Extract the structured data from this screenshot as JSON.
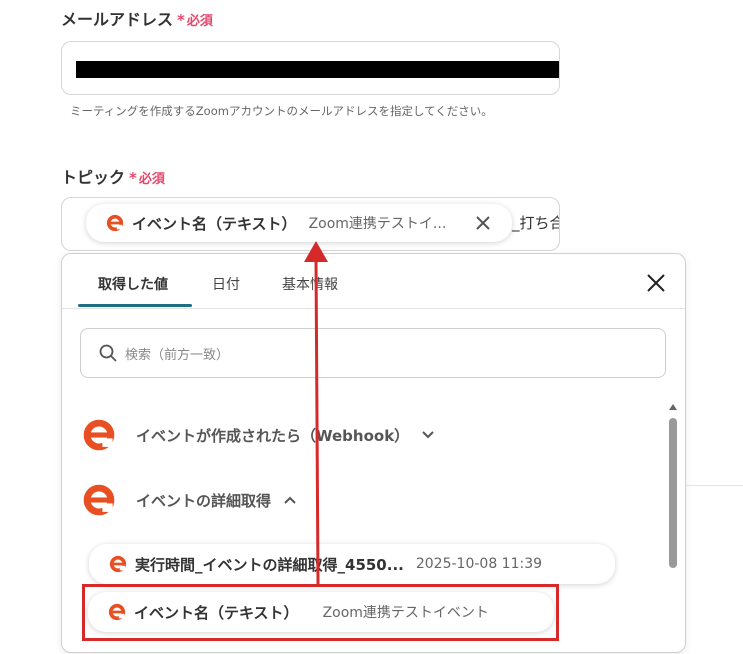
{
  "email_field": {
    "label": "メールアドレス",
    "required_star": "*",
    "required_text": "必須",
    "help_text": "ミーティングを作成するZoomアカウントのメールアドレスを指定してください。"
  },
  "topic_field": {
    "label": "トピック",
    "required_star": "*",
    "required_text": "必須",
    "chip_name": "イベント名（テキスト）",
    "chip_value": "Zoom連携テストイ...",
    "trailing_text": "_打ち合"
  },
  "picker": {
    "tabs": [
      {
        "label": "取得した値"
      },
      {
        "label": "日付"
      },
      {
        "label": "基本情報"
      }
    ],
    "search_placeholder": "検索（前方一致）",
    "groups": [
      {
        "label": "イベントが作成されたら（Webhook）",
        "expanded": false
      },
      {
        "label": "イベントの詳細取得",
        "expanded": true
      }
    ],
    "items": [
      {
        "name": "実行時間_イベントの詳細取得_4550...",
        "value": "2025-10-08 11:39"
      },
      {
        "name": "イベント名（テキスト）",
        "value": "Zoom連携テストイベント"
      }
    ]
  },
  "colors": {
    "brand_icon": "#e84f22",
    "required": "#e5486d",
    "tab_active_underline": "#1e6e86",
    "annotation_red": "#d62929"
  },
  "icons": [
    "e-logo-icon",
    "close-icon",
    "search-icon",
    "chevron-down-icon",
    "chevron-up-icon",
    "arrow-annotation"
  ]
}
